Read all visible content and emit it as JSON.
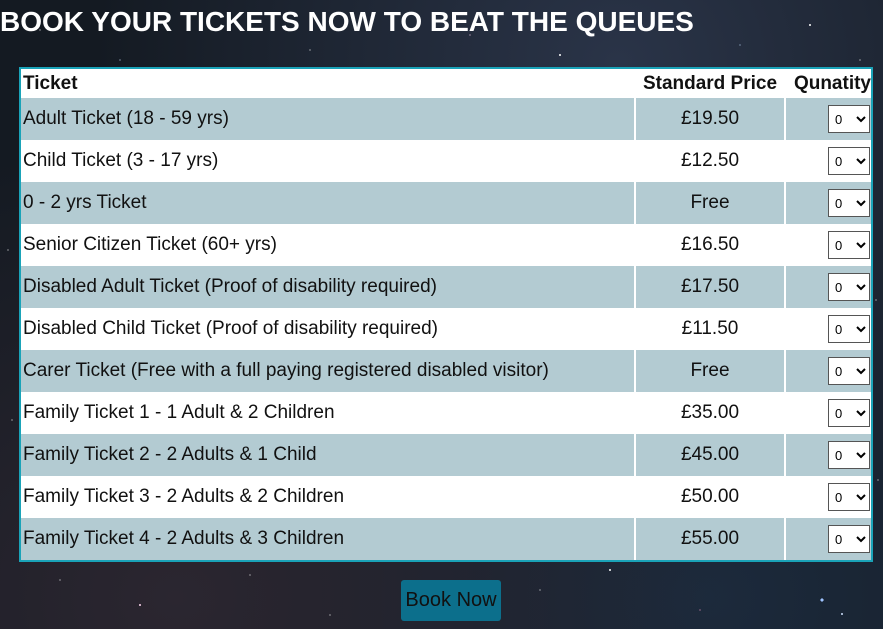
{
  "heading": "BOOK YOUR TICKETS NOW TO BEAT THE QUEUES",
  "table": {
    "headers": {
      "ticket": "Ticket",
      "price": "Standard Price",
      "quantity": "Qunatity"
    },
    "rows": [
      {
        "name": "Adult Ticket (18 - 59 yrs)",
        "price": "£19.50",
        "quantity": "0"
      },
      {
        "name": "Child Ticket (3 - 17 yrs)",
        "price": "£12.50",
        "quantity": "0"
      },
      {
        "name": "0 - 2 yrs Ticket",
        "price": "Free",
        "quantity": "0"
      },
      {
        "name": "Senior Citizen Ticket (60+ yrs)",
        "price": "£16.50",
        "quantity": "0"
      },
      {
        "name": "Disabled Adult Ticket (Proof of disability required)",
        "price": "£17.50",
        "quantity": "0"
      },
      {
        "name": "Disabled Child Ticket (Proof of disability required)",
        "price": "£11.50",
        "quantity": "0"
      },
      {
        "name": "Carer Ticket (Free with a full paying registered disabled visitor)",
        "price": "Free",
        "quantity": "0"
      },
      {
        "name": "Family Ticket 1 - 1 Adult & 2 Children",
        "price": "£35.00",
        "quantity": "0"
      },
      {
        "name": "Family Ticket 2 - 2 Adults & 1 Child",
        "price": "£45.00",
        "quantity": "0"
      },
      {
        "name": "Family Ticket 3 - 2 Adults & 2 Children",
        "price": "£50.00",
        "quantity": "0"
      },
      {
        "name": "Family Ticket 4 - 2 Adults & 3 Children",
        "price": "£55.00",
        "quantity": "0"
      }
    ]
  },
  "book_button": {
    "label": "Book Now"
  },
  "colors": {
    "table_border": "#1aa3b8",
    "row_alt": "#b3cbd2",
    "button_bg": "#0c6f8c"
  }
}
